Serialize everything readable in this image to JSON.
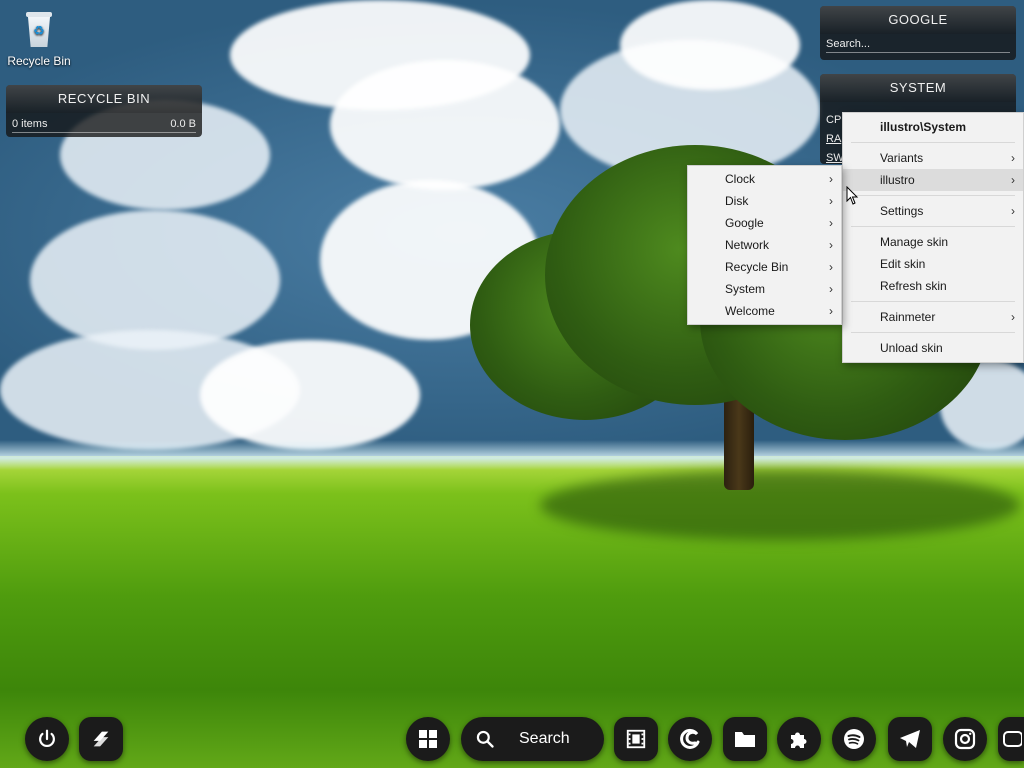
{
  "desktop": {
    "icons": [
      {
        "label": "Recycle Bin",
        "icon": "recycle-bin-icon"
      }
    ]
  },
  "skins": {
    "recycle_bin": {
      "title": "RECYCLE BIN",
      "items": "0 items",
      "size": "0.0 B"
    },
    "google": {
      "title": "GOOGLE",
      "search_placeholder": "Search..."
    },
    "system": {
      "title": "SYSTEM",
      "rows": [
        "CPU",
        "RA",
        "SW"
      ]
    }
  },
  "main_menu": {
    "header": "illustro\\System",
    "items": [
      {
        "label": "Variants",
        "submenu": true
      },
      {
        "label": "illustro",
        "submenu": true,
        "highlighted": true
      },
      {
        "label": "Settings",
        "submenu": true
      },
      {
        "label": "Manage skin",
        "submenu": false
      },
      {
        "label": "Edit skin",
        "submenu": false
      },
      {
        "label": "Refresh skin",
        "submenu": false
      },
      {
        "label": "Rainmeter",
        "submenu": true
      },
      {
        "label": "Unload skin",
        "submenu": false
      }
    ]
  },
  "sub_menu": {
    "items": [
      {
        "label": "Clock"
      },
      {
        "label": "Disk"
      },
      {
        "label": "Google"
      },
      {
        "label": "Network"
      },
      {
        "label": "Recycle Bin"
      },
      {
        "label": "System"
      },
      {
        "label": "Welcome"
      }
    ]
  },
  "taskbar": {
    "left": [
      {
        "icon": "power-icon"
      },
      {
        "icon": "app-logo-icon"
      }
    ],
    "start_icon": "windows-start-icon",
    "search_label": "Search",
    "apps": [
      {
        "icon": "film-strip-icon"
      },
      {
        "icon": "edge-browser-icon"
      },
      {
        "icon": "folder-icon"
      },
      {
        "icon": "puzzle-icon"
      },
      {
        "icon": "spotify-icon"
      },
      {
        "icon": "telegram-icon"
      },
      {
        "icon": "instagram-icon"
      },
      {
        "icon": "youtube-icon"
      }
    ]
  },
  "colors": {
    "menu_bg": "#f2f2f2",
    "menu_highlight": "#dcdcdc",
    "taskbar_btn": "#1b1b1b"
  }
}
